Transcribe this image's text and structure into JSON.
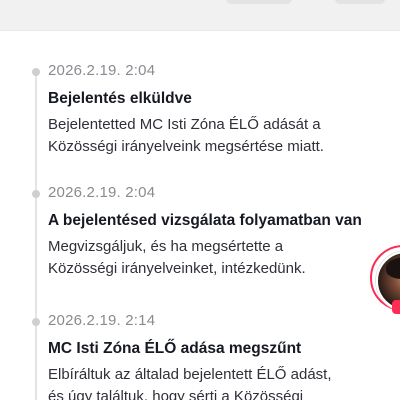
{
  "notifications": [
    {
      "timestamp": "2026.2.19. 2:04",
      "title": "Bejelentés elküldve",
      "body_lines": [
        "Bejelentetted MC Isti Zóna ÉLŐ adását a",
        "Közösségi irányelveink megsértése miatt."
      ]
    },
    {
      "timestamp": "2026.2.19. 2:04",
      "title": "A bejelentésed vizsgálata folyamatban van",
      "body_lines": [
        "Megvizsgáljuk, és ha megsértette a",
        "Közösségi irányelveinket, intézkedünk."
      ]
    },
    {
      "timestamp": "2026.2.19. 2:14",
      "title": "MC Isti Zóna ÉLŐ adása megszűnt",
      "body_lines": [
        "Elbíráltuk az általad bejelentett ÉLŐ adást,",
        "és úgy találtuk, hogy sérti a Közösségi"
      ]
    }
  ],
  "floating_live": {
    "icon": "live-avatar-icon",
    "ring_color": "#fe2c55"
  },
  "colors": {
    "title": "#161823",
    "timestamp": "#8a8b91",
    "body": "#2f3038",
    "dot": "#cfcfd2"
  }
}
